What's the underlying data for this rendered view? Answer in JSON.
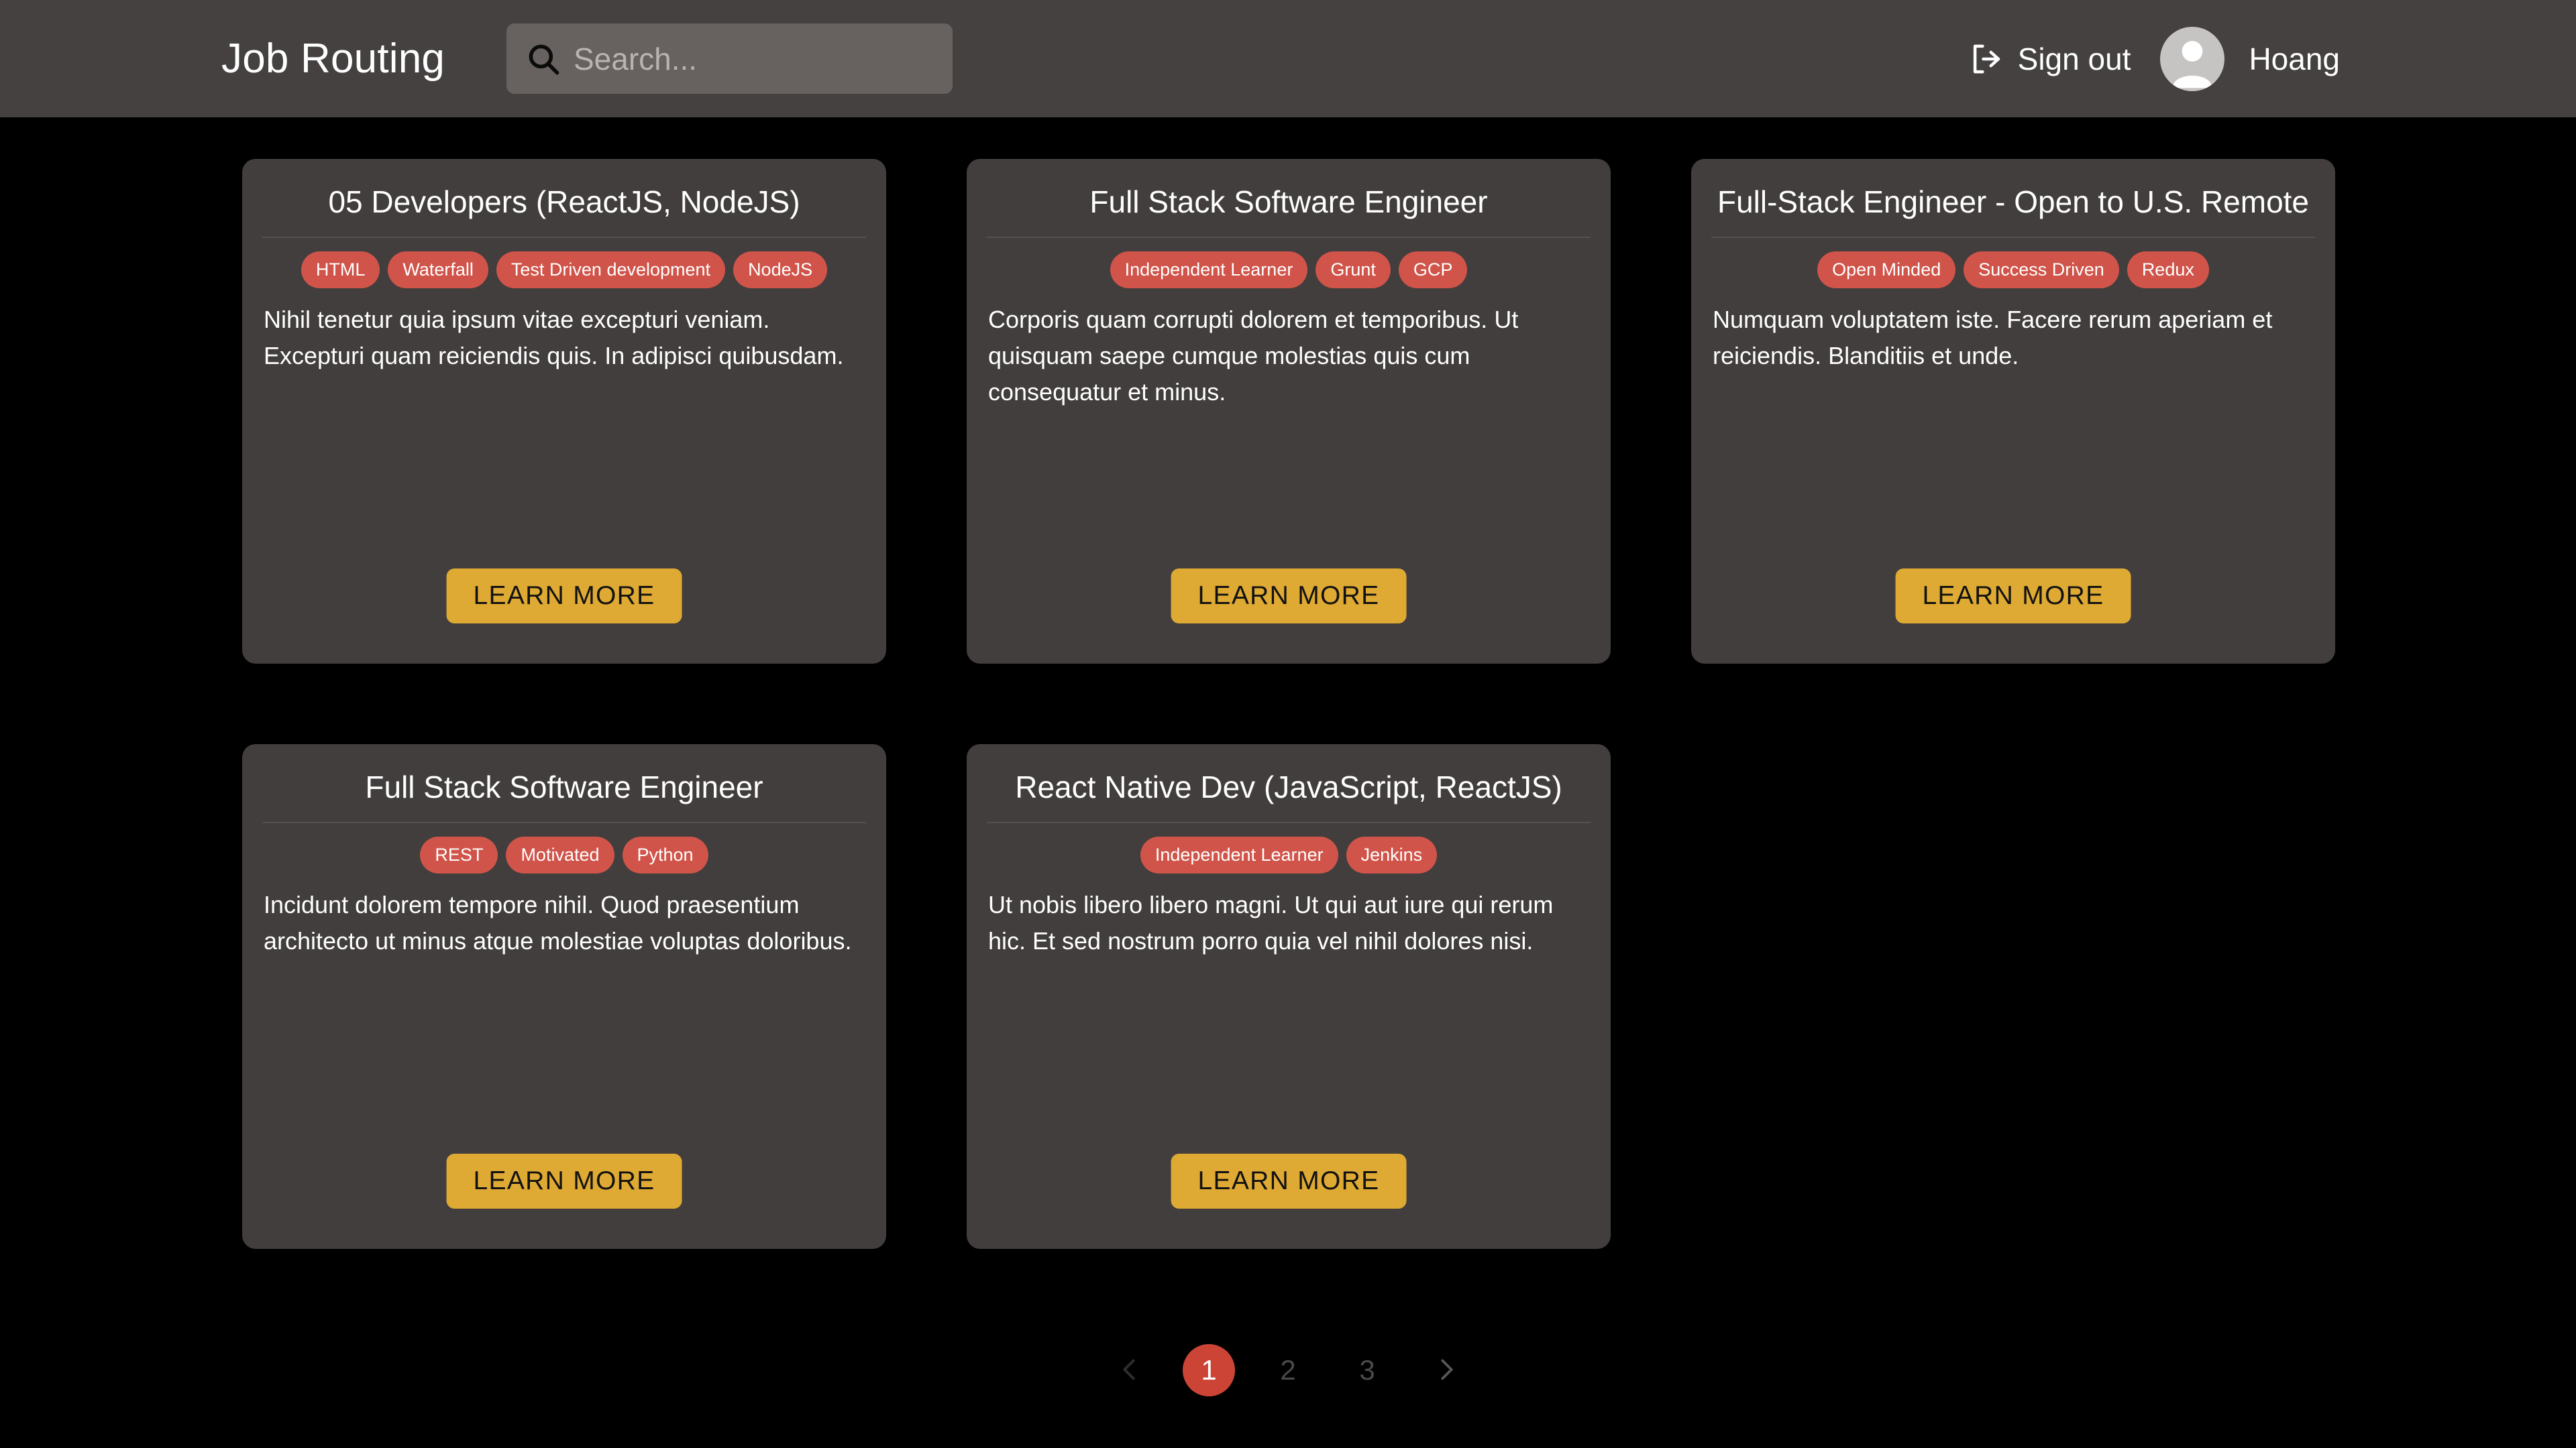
{
  "header": {
    "brand": "Job Routing",
    "search": {
      "placeholder": "Search...",
      "value": "",
      "icon": "search-icon"
    },
    "signout": {
      "label": "Sign out",
      "icon": "logout-icon"
    },
    "user": {
      "name": "Hoang",
      "avatar_icon": "person-avatar-icon"
    }
  },
  "colors": {
    "page_background": "#000000",
    "header_background": "#444140",
    "card_background": "#423e3d",
    "tag": "#d0544a",
    "button": "#dfaa33",
    "active_page": "#cc4436",
    "search_field": "#67625f"
  },
  "cards": [
    {
      "title": "05 Developers (ReactJS, NodeJS)",
      "tags": [
        "HTML",
        "Waterfall",
        "Test Driven development",
        "NodeJS"
      ],
      "description": "Nihil tenetur quia ipsum vitae excepturi veniam. Excepturi quam reiciendis quis. In adipisci quibusdam.",
      "action": "LEARN MORE"
    },
    {
      "title": "Full Stack Software Engineer",
      "tags": [
        "Independent Learner",
        "Grunt",
        "GCP"
      ],
      "description": "Corporis quam corrupti dolorem et temporibus. Ut quisquam saepe cumque molestias quis cum consequatur et minus.",
      "action": "LEARN MORE"
    },
    {
      "title": "Full-Stack Engineer - Open to U.S. Remote",
      "tags": [
        "Open Minded",
        "Success Driven",
        "Redux"
      ],
      "description": "Numquam voluptatem iste. Facere rerum aperiam et reiciendis. Blanditiis et unde.",
      "action": "LEARN MORE"
    },
    {
      "title": "Full Stack Software Engineer",
      "tags": [
        "REST",
        "Motivated",
        "Python"
      ],
      "description": "Incidunt dolorem tempore nihil. Quod praesentium architecto ut minus atque molestiae voluptas doloribus.",
      "action": "LEARN MORE"
    },
    {
      "title": "React Native Dev (JavaScript, ReactJS)",
      "tags": [
        "Independent Learner",
        "Jenkins"
      ],
      "description": "Ut nobis libero libero magni. Ut qui aut iure qui rerum hic. Et sed nostrum porro quia vel nihil dolores nisi.",
      "action": "LEARN MORE"
    }
  ],
  "pagination": {
    "prev_icon": "chevron-left-icon",
    "next_icon": "chevron-right-icon",
    "pages": [
      "1",
      "2",
      "3"
    ],
    "current_page": "1"
  }
}
